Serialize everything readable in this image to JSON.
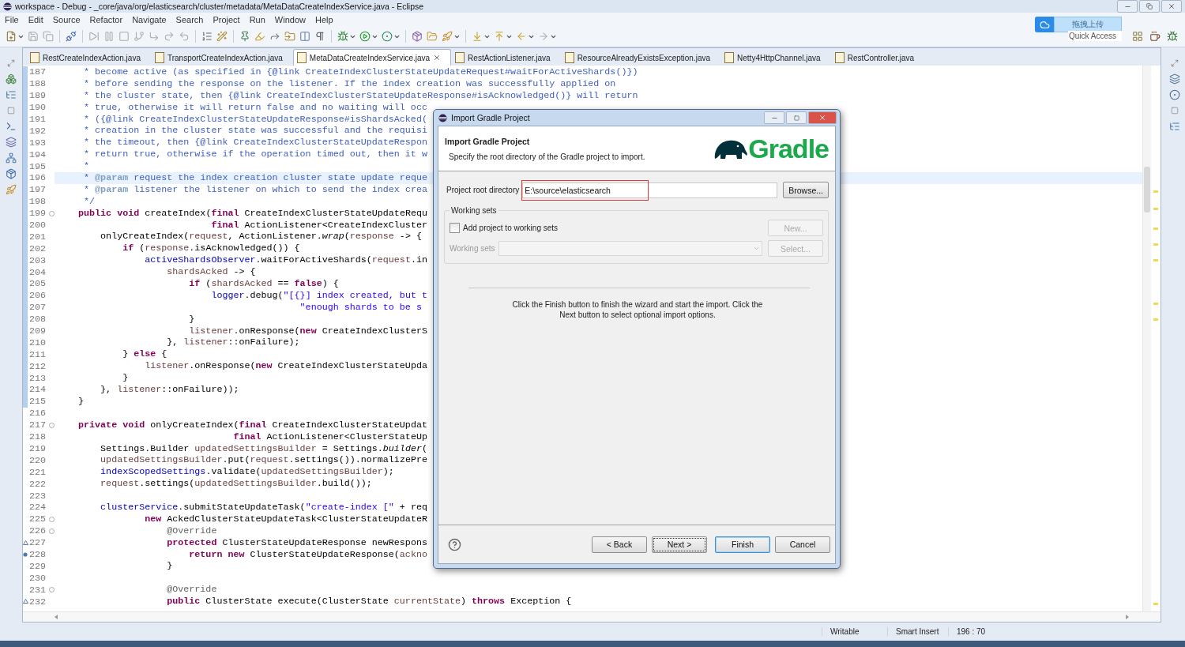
{
  "window": {
    "title": "workspace - Debug - _core/java/org/elasticsearch/cluster/metadata/MetaDataCreateIndexService.java - Eclipse"
  },
  "menu": [
    "File",
    "Edit",
    "Source",
    "Refactor",
    "Navigate",
    "Search",
    "Project",
    "Run",
    "Window",
    "Help"
  ],
  "upload_widget": {
    "label": "拖拽上传"
  },
  "quick_access": {
    "placeholder": "Quick Access"
  },
  "tabs": [
    {
      "label": "RestCreateIndexAction.java",
      "selected": false
    },
    {
      "label": "TransportCreateIndexAction.java",
      "selected": false
    },
    {
      "label": "MetaDataCreateIndexService.java",
      "selected": true
    },
    {
      "label": "RestActionListener.java",
      "selected": false
    },
    {
      "label": "ResourceAlreadyExistsException.java",
      "selected": false
    },
    {
      "label": "Netty4HttpChannel.java",
      "selected": false
    },
    {
      "label": "RestController.java",
      "selected": false
    }
  ],
  "editor": {
    "lines": [
      {
        "number": "187",
        "kind": "plain",
        "changed": true,
        "current": false,
        "folding": false,
        "tokens": [
          {
            "kind": "comment",
            "text": "     * become active (as specified in {@link CreateIndexClusterStateUpdateRequest#waitForActiveShards()})"
          }
        ]
      },
      {
        "number": "188",
        "kind": "plain",
        "changed": true,
        "current": false,
        "folding": false,
        "tokens": [
          {
            "kind": "comment",
            "text": "     * before sending the response on the listener. If the index creation was successfully applied on"
          }
        ]
      },
      {
        "number": "189",
        "kind": "plain",
        "changed": true,
        "current": false,
        "folding": false,
        "tokens": [
          {
            "kind": "comment",
            "text": "     * the cluster state, then {@link CreateIndexClusterStateUpdateResponse#isAcknowledged()} will return"
          }
        ]
      },
      {
        "number": "190",
        "kind": "plain",
        "changed": true,
        "current": false,
        "folding": false,
        "tokens": [
          {
            "kind": "comment",
            "text": "     * true, otherwise it will return false and no waiting will occ"
          }
        ]
      },
      {
        "number": "191",
        "kind": "plain",
        "changed": true,
        "current": false,
        "folding": false,
        "tokens": [
          {
            "kind": "comment",
            "text": "     * ({@link CreateIndexClusterStateUpdateResponse#isShardsAcked("
          }
        ]
      },
      {
        "number": "192",
        "kind": "plain",
        "changed": true,
        "current": false,
        "folding": false,
        "tokens": [
          {
            "kind": "comment",
            "text": "     * creation in the cluster state was successful and the requisi"
          }
        ]
      },
      {
        "number": "193",
        "kind": "plain",
        "changed": true,
        "current": false,
        "folding": false,
        "tokens": [
          {
            "kind": "comment",
            "text": "     * the timeout, then {@link CreateIndexClusterStateUpdateRespon"
          }
        ]
      },
      {
        "number": "194",
        "kind": "plain",
        "changed": true,
        "current": false,
        "folding": false,
        "tokens": [
          {
            "kind": "comment",
            "text": "     * return true, otherwise if the operation timed out, then it w"
          }
        ]
      },
      {
        "number": "195",
        "kind": "plain",
        "changed": true,
        "current": false,
        "folding": false,
        "tokens": [
          {
            "kind": "comment",
            "text": "     *"
          }
        ]
      },
      {
        "number": "196",
        "kind": "plain",
        "changed": true,
        "current": true,
        "folding": false,
        "tokens": [
          {
            "kind": "comment",
            "text": "     * "
          },
          {
            "kind": "doctag",
            "text": "@param"
          },
          {
            "kind": "comment",
            "text": " request the index creation cluster state update reque"
          }
        ]
      },
      {
        "number": "197",
        "kind": "plain",
        "changed": true,
        "current": false,
        "folding": false,
        "tokens": [
          {
            "kind": "comment",
            "text": "     * "
          },
          {
            "kind": "doctag",
            "text": "@param"
          },
          {
            "kind": "comment",
            "text": " listener the listener on which to send the index crea"
          }
        ]
      },
      {
        "number": "198",
        "kind": "plain",
        "changed": true,
        "current": false,
        "folding": false,
        "tokens": [
          {
            "kind": "comment",
            "text": "     */"
          }
        ]
      },
      {
        "number": "199",
        "kind": "plain",
        "changed": true,
        "current": false,
        "folding": true,
        "tokens": [
          {
            "kind": "keyword",
            "text": "    public void"
          },
          {
            "kind": "plain",
            "text": " createIndex("
          },
          {
            "kind": "keyword",
            "text": "final"
          },
          {
            "kind": "plain",
            "text": " CreateIndexClusterStateUpdateRequ"
          }
        ]
      },
      {
        "number": "200",
        "kind": "plain",
        "changed": true,
        "current": false,
        "folding": false,
        "tokens": [
          {
            "kind": "keyword",
            "text": "                            final"
          },
          {
            "kind": "plain",
            "text": " ActionListener<CreateIndexCluster"
          }
        ]
      },
      {
        "number": "201",
        "kind": "plain",
        "changed": true,
        "current": false,
        "folding": false,
        "tokens": [
          {
            "kind": "plain",
            "text": "        onlyCreateIndex("
          },
          {
            "kind": "local",
            "text": "request"
          },
          {
            "kind": "plain",
            "text": ", ActionListener."
          },
          {
            "kind": "italic",
            "text": "wrap"
          },
          {
            "kind": "plain",
            "text": "("
          },
          {
            "kind": "local",
            "text": "response"
          },
          {
            "kind": "plain",
            "text": " -> {"
          }
        ]
      },
      {
        "number": "202",
        "kind": "plain",
        "changed": true,
        "current": false,
        "folding": false,
        "tokens": [
          {
            "kind": "keyword",
            "text": "            if"
          },
          {
            "kind": "plain",
            "text": " ("
          },
          {
            "kind": "local",
            "text": "response"
          },
          {
            "kind": "plain",
            "text": ".isAcknowledged()) {"
          }
        ]
      },
      {
        "number": "203",
        "kind": "plain",
        "changed": true,
        "current": false,
        "folding": false,
        "tokens": [
          {
            "kind": "field",
            "text": "                activeShardsObserver"
          },
          {
            "kind": "plain",
            "text": ".waitForActiveShards("
          },
          {
            "kind": "local",
            "text": "request"
          },
          {
            "kind": "plain",
            "text": ".in"
          }
        ]
      },
      {
        "number": "204",
        "kind": "plain",
        "changed": true,
        "current": false,
        "folding": false,
        "tokens": [
          {
            "kind": "local",
            "text": "                    shardsAcked"
          },
          {
            "kind": "plain",
            "text": " -> {"
          }
        ]
      },
      {
        "number": "205",
        "kind": "plain",
        "changed": true,
        "current": false,
        "folding": false,
        "tokens": [
          {
            "kind": "keyword",
            "text": "                        if"
          },
          {
            "kind": "plain",
            "text": " ("
          },
          {
            "kind": "local",
            "text": "shardsAcked"
          },
          {
            "kind": "plain",
            "text": " == "
          },
          {
            "kind": "keyword",
            "text": "false"
          },
          {
            "kind": "plain",
            "text": ") {"
          }
        ]
      },
      {
        "number": "206",
        "kind": "plain",
        "changed": true,
        "current": false,
        "folding": false,
        "tokens": [
          {
            "kind": "field",
            "text": "                            logger"
          },
          {
            "kind": "plain",
            "text": ".debug("
          },
          {
            "kind": "string",
            "text": "\"[{}] index created, but t"
          }
        ]
      },
      {
        "number": "207",
        "kind": "plain",
        "changed": true,
        "current": false,
        "folding": false,
        "tokens": [
          {
            "kind": "string",
            "text": "                                            \"enough shards to be s"
          }
        ]
      },
      {
        "number": "208",
        "kind": "plain",
        "changed": true,
        "current": false,
        "folding": false,
        "tokens": [
          {
            "kind": "plain",
            "text": "                        }"
          }
        ]
      },
      {
        "number": "209",
        "kind": "plain",
        "changed": true,
        "current": false,
        "folding": false,
        "tokens": [
          {
            "kind": "local",
            "text": "                        listener"
          },
          {
            "kind": "plain",
            "text": ".onResponse("
          },
          {
            "kind": "keyword",
            "text": "new"
          },
          {
            "kind": "plain",
            "text": " CreateIndexClusterS"
          }
        ]
      },
      {
        "number": "210",
        "kind": "plain",
        "changed": true,
        "current": false,
        "folding": false,
        "tokens": [
          {
            "kind": "plain",
            "text": "                    }, "
          },
          {
            "kind": "local",
            "text": "listener"
          },
          {
            "kind": "plain",
            "text": "::onFailure);"
          }
        ]
      },
      {
        "number": "211",
        "kind": "plain",
        "changed": true,
        "current": false,
        "folding": false,
        "tokens": [
          {
            "kind": "plain",
            "text": "            } "
          },
          {
            "kind": "keyword",
            "text": "else"
          },
          {
            "kind": "plain",
            "text": " {"
          }
        ]
      },
      {
        "number": "212",
        "kind": "plain",
        "changed": true,
        "current": false,
        "folding": false,
        "tokens": [
          {
            "kind": "local",
            "text": "                listener"
          },
          {
            "kind": "plain",
            "text": ".onResponse("
          },
          {
            "kind": "keyword",
            "text": "new"
          },
          {
            "kind": "plain",
            "text": " CreateIndexClusterStateUpda"
          }
        ]
      },
      {
        "number": "213",
        "kind": "plain",
        "changed": true,
        "current": false,
        "folding": false,
        "tokens": [
          {
            "kind": "plain",
            "text": "            }"
          }
        ]
      },
      {
        "number": "214",
        "kind": "plain",
        "changed": true,
        "current": false,
        "folding": false,
        "tokens": [
          {
            "kind": "plain",
            "text": "        }, "
          },
          {
            "kind": "local",
            "text": "listener"
          },
          {
            "kind": "plain",
            "text": "::onFailure));"
          }
        ]
      },
      {
        "number": "215",
        "kind": "plain",
        "changed": true,
        "current": false,
        "folding": false,
        "tokens": [
          {
            "kind": "plain",
            "text": "    }"
          }
        ]
      },
      {
        "number": "216",
        "kind": "plain",
        "changed": false,
        "current": false,
        "folding": false
      },
      {
        "number": "217",
        "kind": "plain",
        "changed": false,
        "current": false,
        "folding": true,
        "tokens": [
          {
            "kind": "keyword",
            "text": "    private void"
          },
          {
            "kind": "plain",
            "text": " onlyCreateIndex("
          },
          {
            "kind": "keyword",
            "text": "final"
          },
          {
            "kind": "plain",
            "text": " CreateIndexClusterStateUpdat"
          }
        ]
      },
      {
        "number": "218",
        "kind": "plain",
        "changed": false,
        "current": false,
        "folding": false,
        "tokens": [
          {
            "kind": "keyword",
            "text": "                                final"
          },
          {
            "kind": "plain",
            "text": " ActionListener<ClusterStateUp"
          }
        ]
      },
      {
        "number": "219",
        "kind": "plain",
        "changed": false,
        "current": false,
        "folding": false,
        "tokens": [
          {
            "kind": "plain",
            "text": "        Settings.Builder "
          },
          {
            "kind": "local",
            "text": "updatedSettingsBuilder"
          },
          {
            "kind": "plain",
            "text": " = Settings."
          },
          {
            "kind": "italic",
            "text": "builder"
          },
          {
            "kind": "plain",
            "text": "("
          }
        ]
      },
      {
        "number": "220",
        "kind": "plain",
        "changed": false,
        "current": false,
        "folding": false,
        "tokens": [
          {
            "kind": "local",
            "text": "        updatedSettingsBuilder"
          },
          {
            "kind": "plain",
            "text": ".put("
          },
          {
            "kind": "local",
            "text": "request"
          },
          {
            "kind": "plain",
            "text": ".settings()).normalizePre"
          }
        ]
      },
      {
        "number": "221",
        "kind": "plain",
        "changed": false,
        "current": false,
        "folding": false,
        "tokens": [
          {
            "kind": "field",
            "text": "        indexScopedSettings"
          },
          {
            "kind": "plain",
            "text": ".validate("
          },
          {
            "kind": "local",
            "text": "updatedSettingsBuilder"
          },
          {
            "kind": "plain",
            "text": ");"
          }
        ]
      },
      {
        "number": "222",
        "kind": "plain",
        "changed": false,
        "current": false,
        "folding": false,
        "tokens": [
          {
            "kind": "local",
            "text": "        request"
          },
          {
            "kind": "plain",
            "text": ".settings("
          },
          {
            "kind": "local",
            "text": "updatedSettingsBuilder"
          },
          {
            "kind": "plain",
            "text": ".build());"
          }
        ]
      },
      {
        "number": "223",
        "kind": "plain",
        "changed": false,
        "current": false,
        "folding": false
      },
      {
        "number": "224",
        "kind": "plain",
        "changed": false,
        "current": false,
        "folding": false,
        "tokens": [
          {
            "kind": "field",
            "text": "        clusterService"
          },
          {
            "kind": "plain",
            "text": ".submitStateUpdateTask("
          },
          {
            "kind": "string",
            "text": "\"create-index [\""
          },
          {
            "kind": "plain",
            "text": " + req"
          }
        ]
      },
      {
        "number": "225",
        "kind": "plain",
        "changed": false,
        "current": false,
        "folding": true,
        "tokens": [
          {
            "kind": "keyword",
            "text": "                new"
          },
          {
            "kind": "plain",
            "text": " AckedClusterStateUpdateTask<ClusterStateUpdateR"
          }
        ]
      },
      {
        "number": "226",
        "kind": "plain",
        "changed": false,
        "current": false,
        "folding": true,
        "tokens": [
          {
            "kind": "annotation",
            "text": "                    @Override"
          }
        ]
      },
      {
        "number": "227",
        "kind": "override",
        "changed": false,
        "current": false,
        "folding": false,
        "tokens": [
          {
            "kind": "keyword",
            "text": "                    protected"
          },
          {
            "kind": "plain",
            "text": " ClusterStateUpdateResponse newRespons"
          }
        ]
      },
      {
        "number": "228",
        "kind": "occurrence",
        "changed": false,
        "current": false,
        "folding": false,
        "tokens": [
          {
            "kind": "keyword",
            "text": "                        return new"
          },
          {
            "kind": "plain",
            "text": " ClusterStateUpdateResponse("
          },
          {
            "kind": "local",
            "text": "ackno"
          }
        ]
      },
      {
        "number": "229",
        "kind": "plain",
        "changed": false,
        "current": false,
        "folding": false,
        "tokens": [
          {
            "kind": "plain",
            "text": "                    }"
          }
        ]
      },
      {
        "number": "230",
        "kind": "plain",
        "changed": false,
        "current": false,
        "folding": false
      },
      {
        "number": "231",
        "kind": "plain",
        "changed": false,
        "current": false,
        "folding": true,
        "tokens": [
          {
            "kind": "annotation",
            "text": "                    @Override"
          }
        ]
      },
      {
        "number": "232",
        "kind": "override",
        "changed": false,
        "current": false,
        "folding": false,
        "tokens": [
          {
            "kind": "keyword",
            "text": "                    public"
          },
          {
            "kind": "plain",
            "text": " ClusterState execute(ClusterState "
          },
          {
            "kind": "local",
            "text": "currentState"
          },
          {
            "kind": "plain",
            "text": ") "
          },
          {
            "kind": "keyword",
            "text": "throws"
          },
          {
            "kind": "plain",
            "text": " Exception {"
          }
        ]
      }
    ]
  },
  "status_bar": [
    "Writable",
    "Smart Insert",
    "196 : 70"
  ],
  "dialog": {
    "title": "Import Gradle Project",
    "heading": "Import Gradle Project",
    "description": "Specify the root directory of the Gradle project to import.",
    "logo": "Gradle",
    "root_label": "Project root directory",
    "root_value": "E:\\source\\elasticsearch",
    "browse": "Browse...",
    "working_sets": {
      "legend": "Working sets",
      "checkbox": {
        "label": "Add project to working sets",
        "checked": false
      },
      "new_button": {
        "label": "New...",
        "disabled": true
      },
      "sets_label": "Working sets",
      "select_button": {
        "label": "Select...",
        "disabled": true
      }
    },
    "message": "Click the Finish button to finish the wizard and start the import. Click the Next button to select optional import options.",
    "buttons": [
      {
        "label": "< Back",
        "focused": false,
        "default": false
      },
      {
        "label": "Next >",
        "focused": true,
        "default": false
      },
      {
        "label": "Finish",
        "focused": false,
        "default": true
      },
      {
        "label": "Cancel",
        "focused": false,
        "default": false
      }
    ]
  }
}
